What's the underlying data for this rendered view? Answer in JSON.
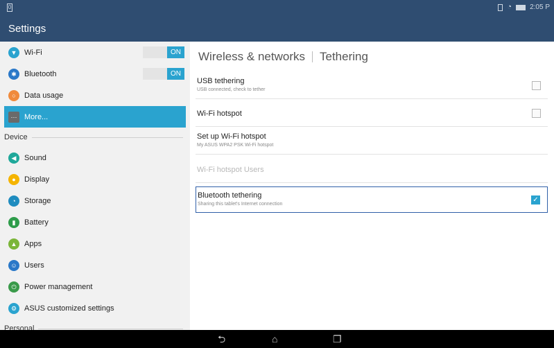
{
  "status_bar": {
    "notification_glyph": "0",
    "time": "2:05 P"
  },
  "app_bar": {
    "title": "Settings"
  },
  "sidebar": {
    "wireless_items": [
      {
        "label": "Wi-Fi",
        "icon": "wifi-icon",
        "color": "#2aa3cf",
        "toggle": "ON"
      },
      {
        "label": "Bluetooth",
        "icon": "bluetooth-icon",
        "color": "#2a78c8",
        "toggle": "ON"
      },
      {
        "label": "Data usage",
        "icon": "data-usage-icon",
        "color": "#f08a3c"
      },
      {
        "label": "More...",
        "icon": "more-icon",
        "color": "#6a6a6a"
      }
    ],
    "device_header": "Device",
    "device_items": [
      {
        "label": "Sound",
        "icon": "sound-icon",
        "color": "#1fa89a"
      },
      {
        "label": "Display",
        "icon": "display-icon",
        "color": "#f5b400"
      },
      {
        "label": "Storage",
        "icon": "storage-icon",
        "color": "#1f8cbf"
      },
      {
        "label": "Battery",
        "icon": "battery-icon",
        "color": "#2e9c4a"
      },
      {
        "label": "Apps",
        "icon": "apps-icon",
        "color": "#7bb539"
      },
      {
        "label": "Users",
        "icon": "users-icon",
        "color": "#2a78c8"
      },
      {
        "label": "Power management",
        "icon": "power-icon",
        "color": "#3a9a4a"
      },
      {
        "label": "ASUS customized settings",
        "icon": "asus-icon",
        "color": "#2aa3cf"
      }
    ],
    "personal_header": "Personal"
  },
  "content": {
    "breadcrumb_parent": "Wireless & networks",
    "breadcrumb_current": "Tethering",
    "rows": [
      {
        "title": "USB tethering",
        "subtitle": "USB connected, check to tether",
        "checked": false
      },
      {
        "title": "Wi-Fi hotspot",
        "subtitle": "",
        "checked": false
      },
      {
        "title": "Set up Wi-Fi hotspot",
        "subtitle": "My ASUS WPA2 PSK Wi-Fi hotspot"
      },
      {
        "title": "Wi-Fi hotspot Users",
        "subtitle": "",
        "disabled": true
      },
      {
        "title": "Bluetooth tethering",
        "subtitle": "Sharing this tablet's Internet connection",
        "checked": true
      }
    ]
  },
  "nav_bar": {
    "back_glyph": "⮌",
    "home_glyph": "⌂",
    "recents_glyph": "❐"
  }
}
